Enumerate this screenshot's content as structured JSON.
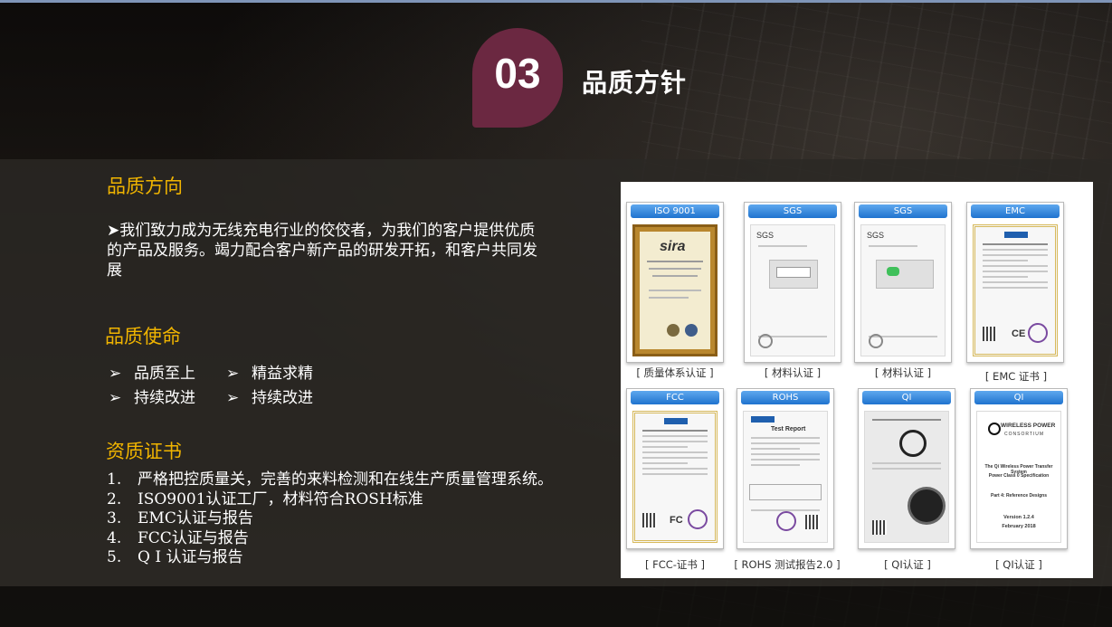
{
  "header": {
    "number": "03",
    "title": "品质方针"
  },
  "sections": {
    "direction": {
      "heading": "品质方向",
      "text": "➤我们致力成为无线充电行业的佼佼者，为我们的客户提供优质的产品及服务。竭力配合客户新产品的研发开拓，和客户共同发展"
    },
    "mission": {
      "heading": "品质使命",
      "bullet_symbol": "➢",
      "items": [
        "品质至上",
        "精益求精",
        "持续改进",
        "持续改进"
      ]
    },
    "certificates": {
      "heading": "资质证书",
      "items": [
        {
          "num": "1.",
          "text": "严格把控质量关，完善的来料检测和在线生产质量管理系统。"
        },
        {
          "num": "2.",
          "text": "ISO9001认证工厂，材料符合ROSH标准"
        },
        {
          "num": "3.",
          "text": "EMC认证与报告"
        },
        {
          "num": "4.",
          "text": "FCC认证与报告"
        },
        {
          "num": "5.",
          "text": "Q I 认证与报告"
        }
      ]
    }
  },
  "gallery": {
    "cards": [
      {
        "header": "ISO 9001",
        "caption": "[ 质量体系认证 ]"
      },
      {
        "header": "SGS",
        "caption": "[ 材料认证 ]"
      },
      {
        "header": "SGS",
        "caption": "[ 材料认证 ]"
      },
      {
        "header": "EMC",
        "caption": "[ EMC 证书 ]"
      },
      {
        "header": "FCC",
        "caption": "[ FCC-证书 ]"
      },
      {
        "header": "ROHS",
        "caption": "[ ROHS 测试报告2.0 ]"
      },
      {
        "header": "QI",
        "caption": "[ QI认证 ]"
      },
      {
        "header": "QI",
        "caption": "[ QI认证 ]"
      }
    ],
    "doc_text": {
      "sira": "sira",
      "sgs": "SGS",
      "ce": "CE",
      "fcc": "FC",
      "test_report": "Test Report",
      "qi_brand": "WIRELESS POWER",
      "qi_consortium": "CONSORTIUM",
      "qi_system": "The Qi Wireless Power Transfer System",
      "qi_class": "Power Class 0 Specification",
      "qi_part": "Part 4: Reference Designs",
      "qi_version": "Version 1.2.4",
      "qi_date": "February 2018"
    }
  }
}
